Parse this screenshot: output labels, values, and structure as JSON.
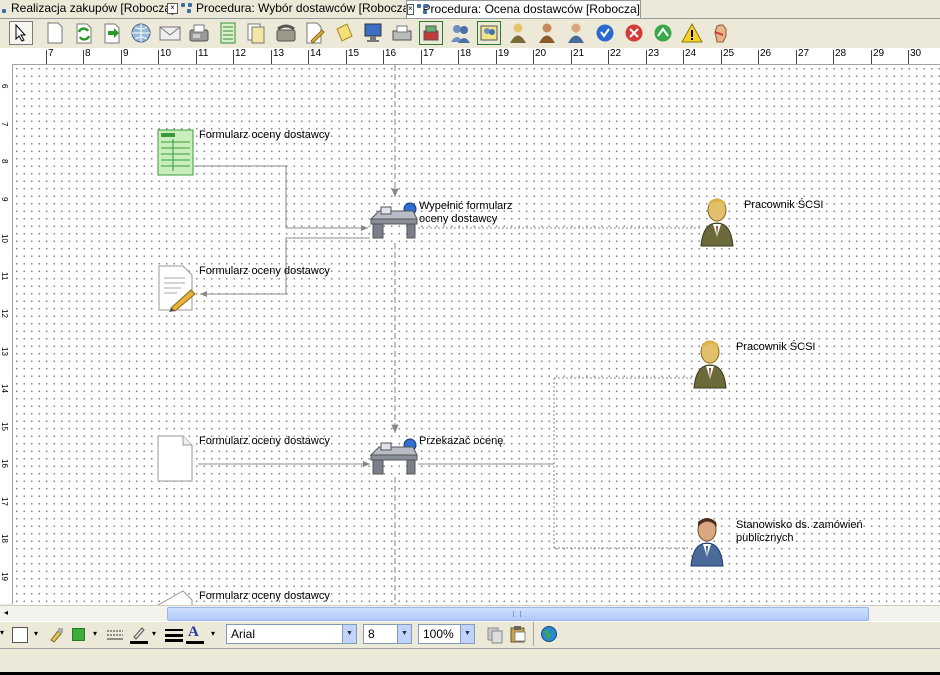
{
  "tabs": [
    {
      "label": "Realizacja zakupów [Robocza]"
    },
    {
      "label": "Procedura: Wybór dostawców [Robocza]"
    },
    {
      "label": "Procedura: Ocena dostawców [Robocza]"
    }
  ],
  "toolbar": {
    "icons": [
      "pointer-icon",
      "blank-document-icon",
      "refresh-document-icon",
      "forward-document-icon",
      "globe-icon",
      "envelope-icon",
      "fax-icon",
      "form-icon",
      "documents-icon",
      "phone-icon",
      "edit-document-icon",
      "note-icon",
      "computer-icon",
      "printer-icon",
      "cash-register-icon",
      "group-icon",
      "group-frame-icon",
      "person-gold-icon",
      "person-brown-icon",
      "person-blue-icon",
      "check-circle-icon",
      "cancel-circle-icon",
      "up-circle-icon",
      "warning-icon",
      "hand-icon"
    ]
  },
  "ruler": {
    "labels": [
      "7",
      "8",
      "9",
      "10",
      "11",
      "12",
      "13",
      "14",
      "15",
      "16",
      "17",
      "18",
      "19",
      "20",
      "21",
      "22",
      "23",
      "24",
      "25",
      "26",
      "27",
      "28",
      "29",
      "30"
    ],
    "vlabels": [
      "6",
      "7",
      "8",
      "9",
      "10",
      "11",
      "12",
      "13",
      "14",
      "15",
      "16",
      "17",
      "18",
      "19"
    ]
  },
  "diagram": {
    "doc1_label": "Formularz oceny dostawcy",
    "doc2_label": "Formularz oceny dostawcy",
    "doc3_label": "Formularz oceny dostawcy",
    "doc4_label": "Formularz oceny dostawcy",
    "task1_label_1": "Wypełnić formularz",
    "task1_label_2": "oceny dostawcy",
    "task2_label": "Przekazać ocenę",
    "person1_label": "Pracownik ŚCSI",
    "person2_label": "Pracownik ŚCSI",
    "person3_label_1": "Stanowisko ds. zamówień",
    "person3_label_2": "publicznych"
  },
  "format": {
    "font": "Arial",
    "size": "8",
    "zoom": "100%"
  },
  "colors": {
    "accent": "#3a6ea5",
    "canvas": "#ffffff",
    "chrome": "#ece9d8"
  }
}
